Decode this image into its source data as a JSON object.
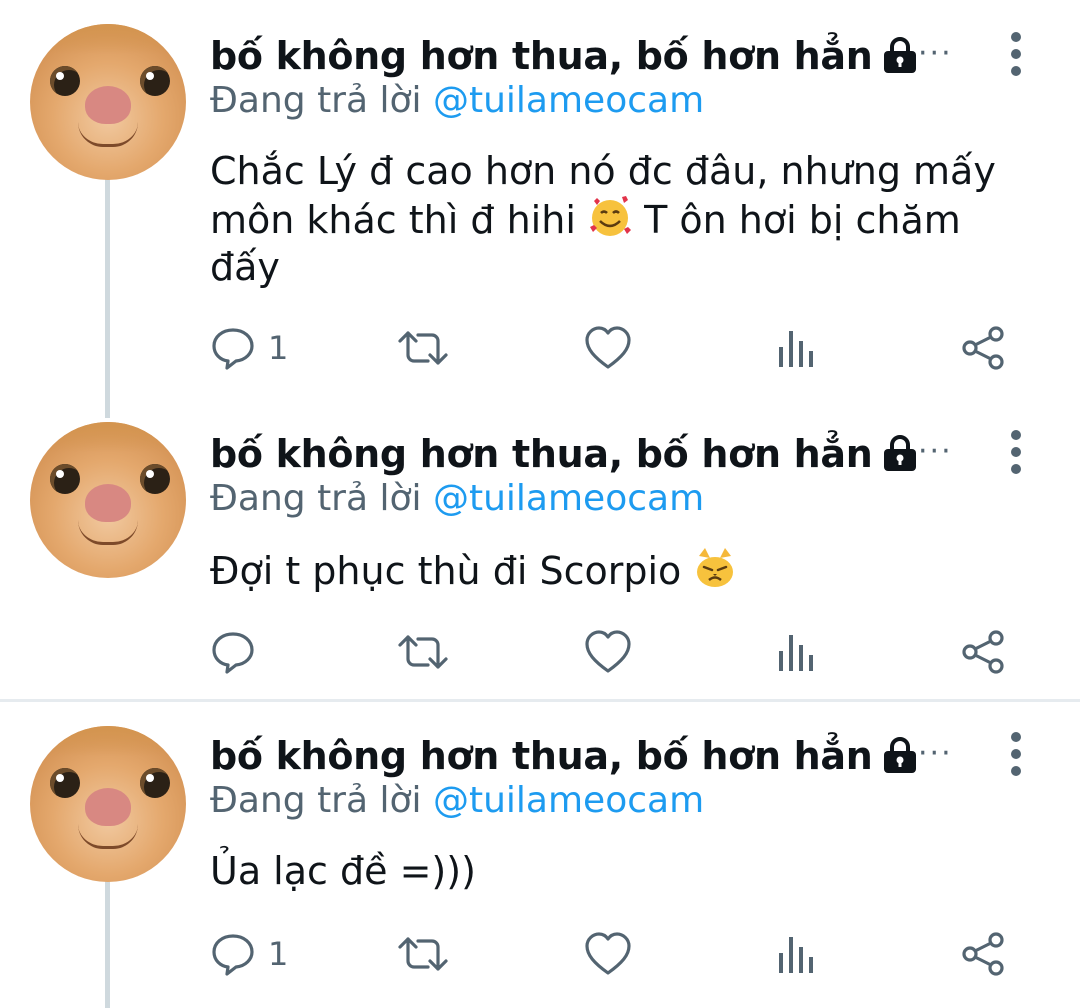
{
  "tweets": [
    {
      "author": "bố không hơn thua, bố hơn hẳn",
      "more_h": "···",
      "reply_prefix": "Đang trả lời",
      "reply_handle": "@tuilameocam",
      "text_before": "Chắc Lý đ cao hơn nó đc đâu, nhưng mấy môn khác thì đ hihi",
      "emoji": "smiling-face-with-hearts-emoji",
      "text_after": "T ôn hơi bị chăm đấy",
      "reply_count": "1"
    },
    {
      "author": "bố không hơn thua, bố hơn hẳn",
      "more_h": "···",
      "reply_prefix": "Đang trả lời",
      "reply_handle": "@tuilameocam",
      "text_before": "Đợi t phục thù đi Scorpio",
      "emoji": "pouting-cat-emoji",
      "text_after": "",
      "reply_count": ""
    },
    {
      "author": "bố không hơn thua, bố hơn hẳn",
      "more_h": "···",
      "reply_prefix": "Đang trả lời",
      "reply_handle": "@tuilameocam",
      "text_before": "Ủa lạc đề =)))",
      "emoji": "",
      "text_after": "",
      "reply_count": "1"
    }
  ],
  "colors": {
    "link": "#1d9bf0",
    "secondary_text": "#536471",
    "thread_line": "#cfd9de"
  }
}
